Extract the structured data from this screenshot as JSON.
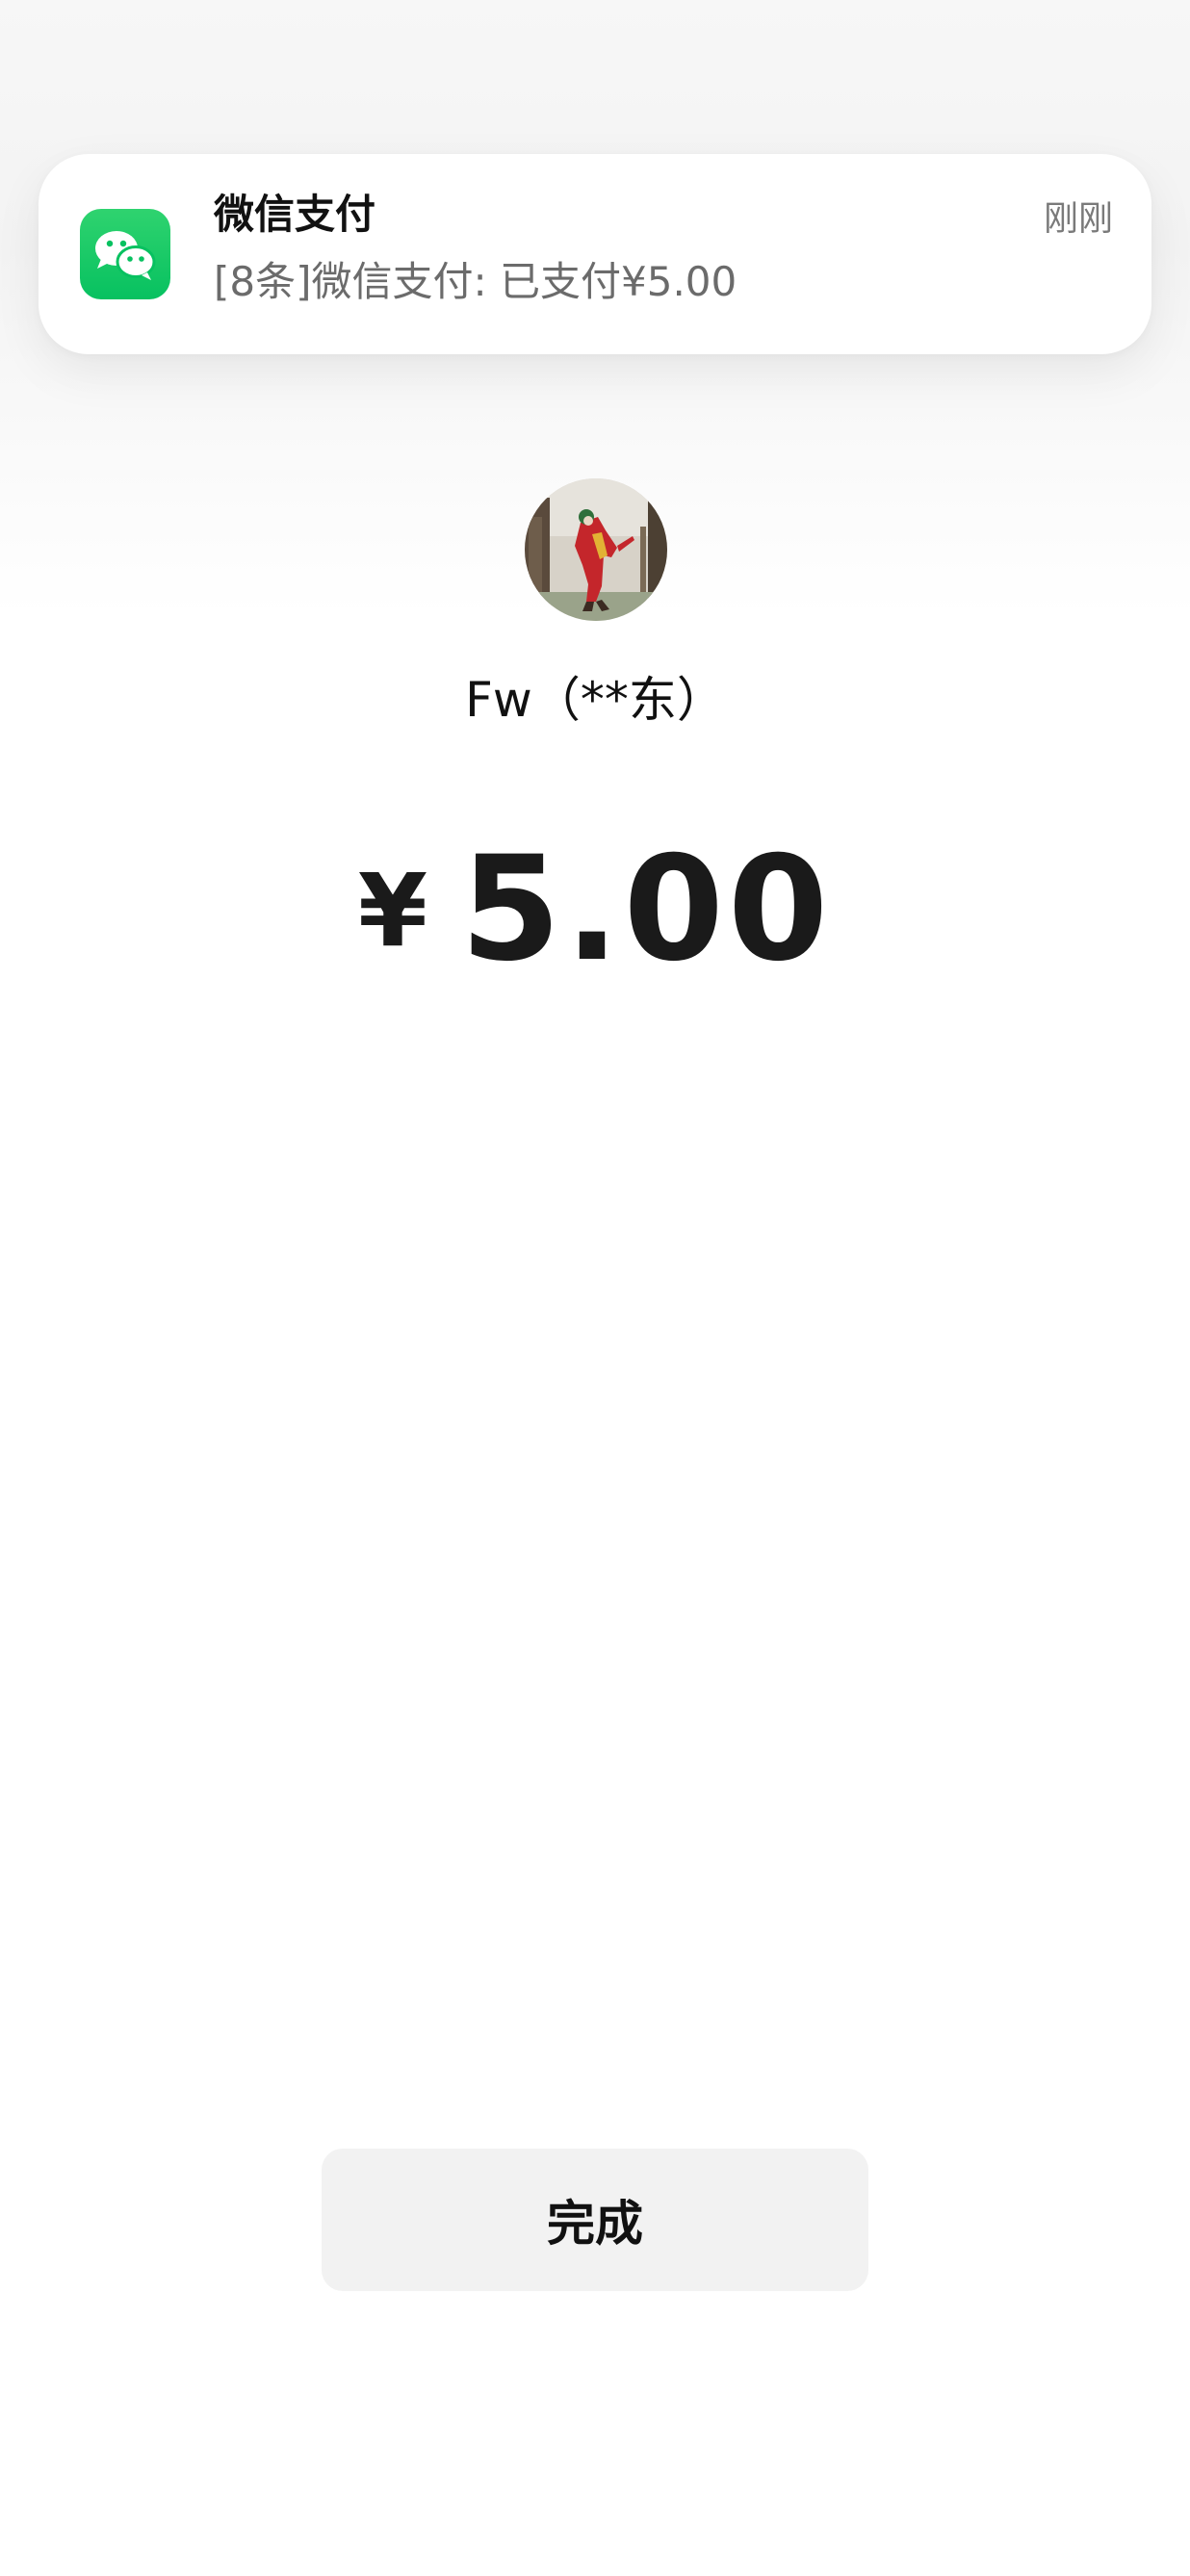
{
  "notification": {
    "app_title": "微信支付",
    "message": "[8条]微信支付: 已支付¥5.00",
    "time": "刚刚",
    "icon": "wechat-icon",
    "icon_color": "#07C160"
  },
  "payee": {
    "name": "Fw（**东）",
    "avatar": "avatar-image"
  },
  "payment": {
    "currency": "¥",
    "amount": "5.00"
  },
  "actions": {
    "done_label": "完成"
  }
}
